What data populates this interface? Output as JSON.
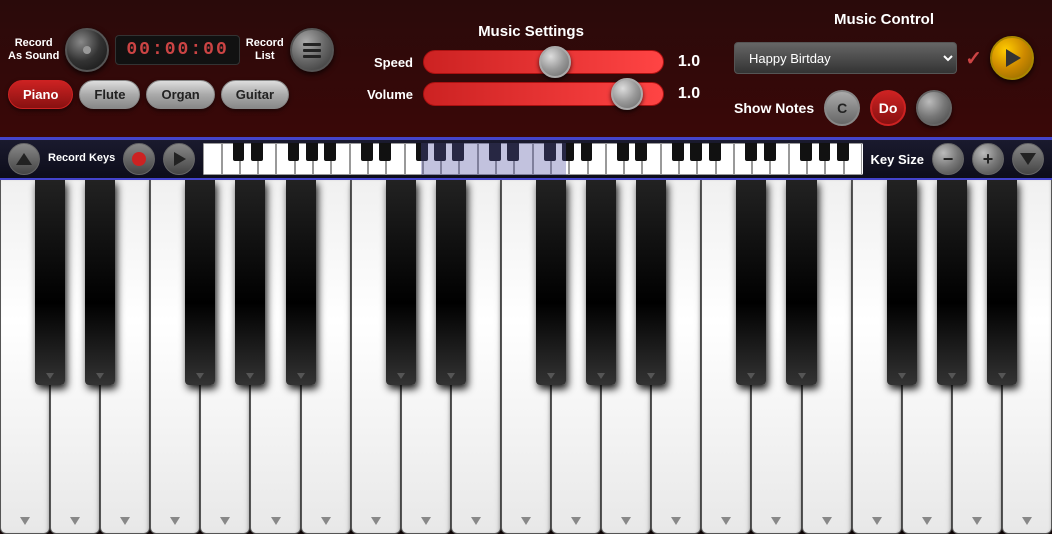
{
  "header": {
    "record_as_sound_label": "Record\nAs Sound",
    "record_as_sound_line1": "Record",
    "record_as_sound_line2": "As Sound",
    "timer": "00:00:00",
    "record_list_label": "Record\nList",
    "record_list_line1": "Record",
    "record_list_line2": "List"
  },
  "instruments": {
    "list": [
      "Piano",
      "Flute",
      "Organ",
      "Guitar"
    ],
    "active": "Piano"
  },
  "music_settings": {
    "title": "Music Settings",
    "speed_label": "Speed",
    "speed_value": "1.0",
    "speed_position": "55%",
    "volume_label": "Volume",
    "volume_value": "1.0",
    "volume_position": "90%"
  },
  "music_control": {
    "title": "Music Control",
    "song_name": "Happy Birtday",
    "show_notes_label": "Show Notes",
    "note_c": "C",
    "note_do": "Do"
  },
  "keyboard_toolbar": {
    "record_keys_label": "Record\nKeys",
    "key_size_label": "Key Size",
    "minus_label": "−",
    "plus_label": "+"
  },
  "piano": {
    "white_key_count": 21,
    "black_key_positions": [
      4.5,
      9.0,
      18.5,
      23.0,
      27.5,
      37.0,
      41.5,
      51.0,
      55.5,
      60.0,
      69.5,
      74.0,
      83.5,
      88.0,
      92.5
    ]
  }
}
